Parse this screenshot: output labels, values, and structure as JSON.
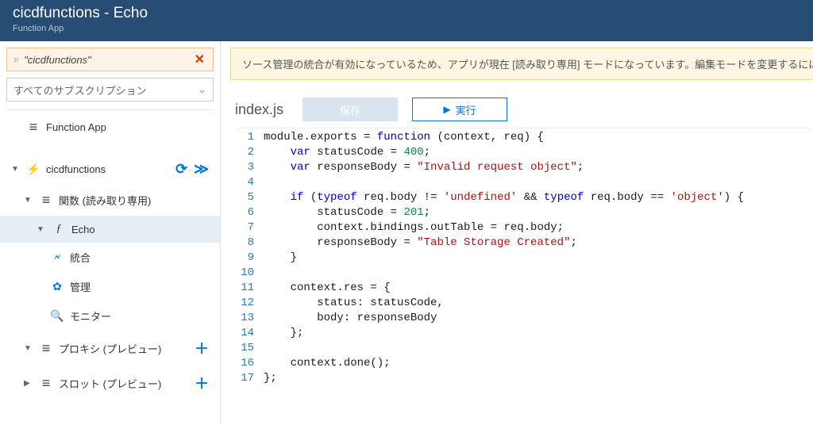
{
  "header": {
    "title": "cicdfunctions - Echo",
    "subtitle": "Function App"
  },
  "sidebar": {
    "search_value": "\"cicdfunctions\"",
    "subscription_label": "すべてのサブスクリプション",
    "root_label": "Function App",
    "app_label": "cicdfunctions",
    "functions_label": "関数 (読み取り専用)",
    "echo_label": "Echo",
    "integration_label": "統合",
    "manage_label": "管理",
    "monitor_label": "モニター",
    "proxy_label": "プロキシ (プレビュー)",
    "slot_label": "スロット (プレビュー)"
  },
  "main": {
    "banner": "ソース管理の統合が有効になっているため、アプリが現在 [読み取り専用] モードになっています。編集モードを変更するには",
    "filename": "index.js",
    "save_label": "保存",
    "run_label": "実行"
  },
  "code": {
    "lines": [
      {
        "n": 1,
        "seg": [
          [
            "id",
            "module"
          ],
          [
            "id",
            "."
          ],
          [
            "id",
            "exports "
          ],
          [
            "id",
            "= "
          ],
          [
            "kw",
            "function"
          ],
          [
            "id",
            " (context, req) {"
          ]
        ]
      },
      {
        "n": 2,
        "seg": [
          [
            "id",
            "    "
          ],
          [
            "kw",
            "var"
          ],
          [
            "id",
            " statusCode = "
          ],
          [
            "num",
            "400"
          ],
          [
            "id",
            ";"
          ]
        ]
      },
      {
        "n": 3,
        "seg": [
          [
            "id",
            "    "
          ],
          [
            "kw",
            "var"
          ],
          [
            "id",
            " responseBody = "
          ],
          [
            "str",
            "\"Invalid request object\""
          ],
          [
            "id",
            ";"
          ]
        ]
      },
      {
        "n": 4,
        "seg": [
          [
            "id",
            ""
          ]
        ]
      },
      {
        "n": 5,
        "seg": [
          [
            "id",
            "    "
          ],
          [
            "kw",
            "if"
          ],
          [
            "id",
            " ("
          ],
          [
            "kw",
            "typeof"
          ],
          [
            "id",
            " req.body != "
          ],
          [
            "str",
            "'undefined'"
          ],
          [
            "id",
            " && "
          ],
          [
            "kw",
            "typeof"
          ],
          [
            "id",
            " req.body == "
          ],
          [
            "str",
            "'object'"
          ],
          [
            "id",
            ") {"
          ]
        ]
      },
      {
        "n": 6,
        "seg": [
          [
            "id",
            "        statusCode = "
          ],
          [
            "num",
            "201"
          ],
          [
            "id",
            ";"
          ]
        ]
      },
      {
        "n": 7,
        "seg": [
          [
            "id",
            "        context.bindings.outTable = req.body;"
          ]
        ]
      },
      {
        "n": 8,
        "seg": [
          [
            "id",
            "        responseBody = "
          ],
          [
            "str",
            "\"Table Storage Created\""
          ],
          [
            "id",
            ";"
          ]
        ]
      },
      {
        "n": 9,
        "seg": [
          [
            "id",
            "    }"
          ]
        ]
      },
      {
        "n": 10,
        "seg": [
          [
            "id",
            ""
          ]
        ]
      },
      {
        "n": 11,
        "seg": [
          [
            "id",
            "    context.res = {"
          ]
        ]
      },
      {
        "n": 12,
        "seg": [
          [
            "id",
            "        status: statusCode,"
          ]
        ]
      },
      {
        "n": 13,
        "seg": [
          [
            "id",
            "        body: responseBody"
          ]
        ]
      },
      {
        "n": 14,
        "seg": [
          [
            "id",
            "    };"
          ]
        ]
      },
      {
        "n": 15,
        "seg": [
          [
            "id",
            ""
          ]
        ]
      },
      {
        "n": 16,
        "seg": [
          [
            "id",
            "    context.done();"
          ]
        ]
      },
      {
        "n": 17,
        "seg": [
          [
            "id",
            "};"
          ]
        ]
      }
    ]
  }
}
